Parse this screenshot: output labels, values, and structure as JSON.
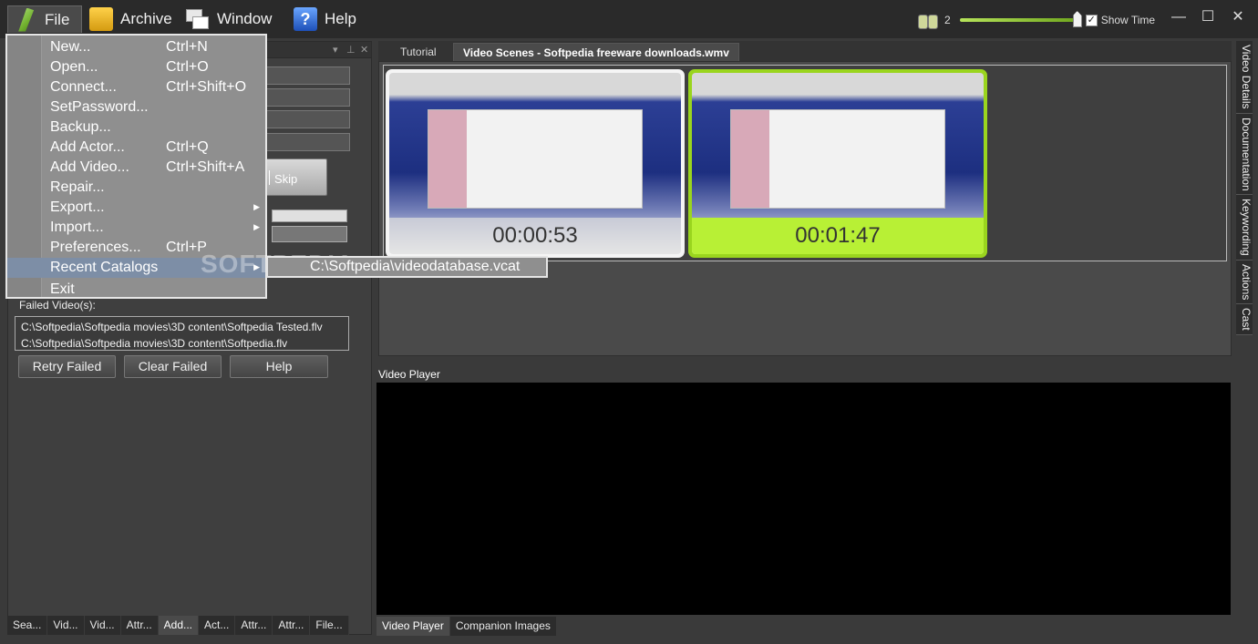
{
  "menubar": {
    "file": "File",
    "archive": "Archive",
    "window": "Window",
    "help": "Help",
    "zoom_value": "2",
    "show_time_label": "Show Time",
    "show_time_checked": true
  },
  "window_controls": {
    "minimize": "—",
    "maximize": "☐",
    "close": "✕"
  },
  "file_menu": {
    "items": [
      {
        "label": "New...",
        "shortcut": "Ctrl+N"
      },
      {
        "label": "Open...",
        "shortcut": "Ctrl+O"
      },
      {
        "label": "Connect...",
        "shortcut": "Ctrl+Shift+O"
      },
      {
        "label": "SetPassword...",
        "shortcut": ""
      },
      {
        "label": "Backup...",
        "shortcut": ""
      },
      {
        "label": "Add Actor...",
        "shortcut": "Ctrl+Q"
      },
      {
        "label": "Add Video...",
        "shortcut": "Ctrl+Shift+A"
      },
      {
        "label": "Repair...",
        "shortcut": ""
      },
      {
        "label": "Export...",
        "shortcut": "",
        "submenu": true
      },
      {
        "label": "Import...",
        "shortcut": "",
        "submenu": true
      },
      {
        "label": "Preferences...",
        "shortcut": "Ctrl+P"
      },
      {
        "label": "Recent Catalogs",
        "shortcut": "",
        "submenu": true
      },
      {
        "label": "Exit",
        "shortcut": ""
      }
    ],
    "recent_catalog": "C:\\Softpedia\\videodatabase.vcat",
    "watermark": "SOFTPEDIA"
  },
  "left_panel": {
    "skip_label": "Skip",
    "failed_label": "Failed Video(s):",
    "failed_videos": [
      "C:\\Softpedia\\Softpedia movies\\3D content\\Softpedia Tested.flv",
      "C:\\Softpedia\\Softpedia movies\\3D content\\Softpedia.flv"
    ],
    "retry_label": "Retry Failed",
    "clear_label": "Clear Failed",
    "help_label": "Help",
    "bottom_tabs": [
      "Sea...",
      "Vid...",
      "Vid...",
      "Attr...",
      "Add...",
      "Act...",
      "Attr...",
      "Attr...",
      "File..."
    ]
  },
  "doc_tabs": {
    "tutorial": "Tutorial",
    "video_scenes": "Video Scenes - Softpedia freeware downloads.wmv"
  },
  "scenes": [
    {
      "time": "00:00:53",
      "selected": false
    },
    {
      "time": "00:01:47",
      "selected": true
    }
  ],
  "player": {
    "title": "Video Player",
    "tabs": [
      "Video Player",
      "Companion Images"
    ]
  },
  "side_tabs": [
    "Video Details",
    "Documentation",
    "Keywording",
    "Actions",
    "Cast"
  ],
  "colors": {
    "accent_green": "#9ad51e",
    "menu_highlight": "#7d8ea6"
  }
}
